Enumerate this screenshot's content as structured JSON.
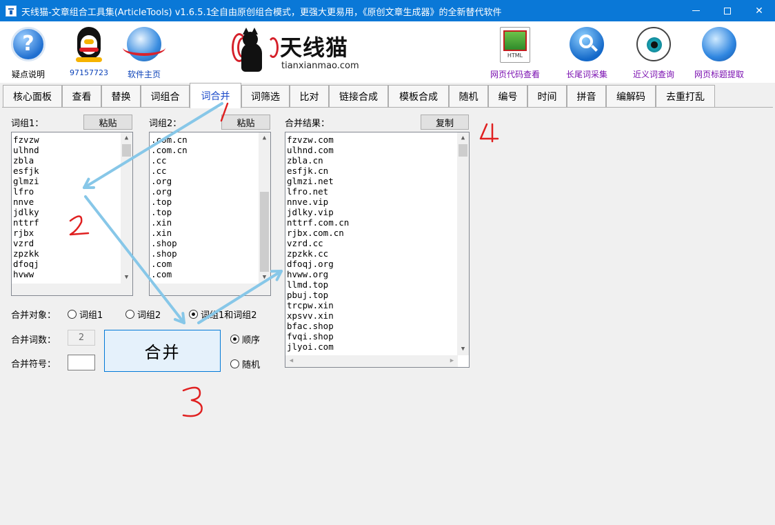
{
  "window": {
    "title": "天线猫-文章组合工具集(ArticleTools) v1.6.5.1",
    "slogan": "全自由原创组合模式，更强大更易用，《原创文章生成器》的全新替代软件"
  },
  "toolbar": {
    "help_label": "疑点说明",
    "qq_label": "97157723",
    "homepage_label": "软件主页",
    "html_label": "网页代码查看",
    "longtail_label": "长尾词采集",
    "synonym_label": "近义词查询",
    "title_extract_label": "网页标题提取"
  },
  "logo": {
    "cn": "天线猫",
    "en": "tianxianmao.com"
  },
  "tabs": [
    {
      "label": "核心面板"
    },
    {
      "label": "查看"
    },
    {
      "label": "替换"
    },
    {
      "label": "词组合"
    },
    {
      "label": "词合并"
    },
    {
      "label": "词筛选"
    },
    {
      "label": "比对"
    },
    {
      "label": "链接合成"
    },
    {
      "label": "模板合成"
    },
    {
      "label": "随机"
    },
    {
      "label": "编号"
    },
    {
      "label": "时间"
    },
    {
      "label": "拼音"
    },
    {
      "label": "编解码"
    },
    {
      "label": "去重打乱"
    }
  ],
  "active_tab": "词合并",
  "group1": {
    "label": "词组1：",
    "paste_label": "粘贴",
    "items": [
      "fzvzw",
      "ulhnd",
      "zbla",
      "esfjk",
      "glmzi",
      "lfro",
      "nnve",
      "jdlky",
      "nttrf",
      "rjbx",
      "vzrd",
      "zpzkk",
      "dfoqj",
      "hvww"
    ]
  },
  "group2": {
    "label": "词组2：",
    "paste_label": "粘贴",
    "items": [
      ".com.cn",
      ".com.cn",
      ".cc",
      ".cc",
      ".org",
      ".org",
      ".top",
      ".top",
      ".xin",
      ".xin",
      ".shop",
      ".shop",
      ".com",
      ".com"
    ]
  },
  "result": {
    "label": "合并结果：",
    "copy_label": "复制",
    "items": [
      "fzvzw.com",
      "ulhnd.com",
      "zbla.cn",
      "esfjk.cn",
      "glmzi.net",
      "lfro.net",
      "nnve.vip",
      "jdlky.vip",
      "nttrf.com.cn",
      "rjbx.com.cn",
      "vzrd.cc",
      "zpzkk.cc",
      "dfoqj.org",
      "hvww.org",
      "llmd.top",
      "pbuj.top",
      "trcpw.xin",
      "xpsvv.xin",
      "bfac.shop",
      "fvqi.shop",
      "jlyoi.com"
    ]
  },
  "options": {
    "target_label": "合并对象：",
    "target_group1": "词组1",
    "target_group2": "词组2",
    "target_both": "词组1和词组2",
    "selected_target": "both",
    "count_label": "合并词数：",
    "count_value": "2",
    "symbol_label": "合并符号：",
    "symbol_value": "",
    "order_label": "顺序",
    "random_label": "随机",
    "selected_order": "order",
    "merge_button": "合并"
  },
  "annotations": {
    "arrow_color": "#87c7e8",
    "number_color": "#e02020",
    "labels": [
      "1",
      "2",
      "3",
      "4"
    ]
  }
}
